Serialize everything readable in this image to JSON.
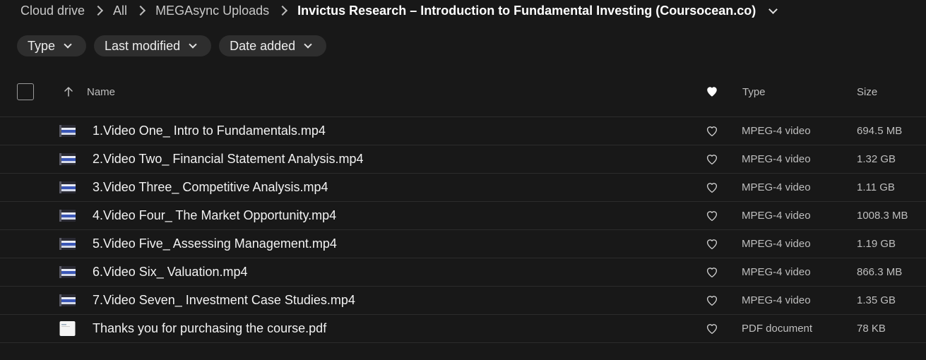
{
  "breadcrumb": {
    "items": [
      "Cloud drive",
      "All",
      "MEGAsync Uploads"
    ],
    "current": "Invictus Research – Introduction to Fundamental Investing (Coursocean.co)"
  },
  "filters": [
    {
      "label": "Type"
    },
    {
      "label": "Last modified"
    },
    {
      "label": "Date added"
    }
  ],
  "table": {
    "columns": {
      "name": "Name",
      "type": "Type",
      "size": "Size"
    },
    "rows": [
      {
        "name": "1.Video One_ Intro to Fundamentals.mp4",
        "type": "MPEG-4 video",
        "size": "694.5 MB",
        "icon": "video-thumbnail-icon"
      },
      {
        "name": "2.Video Two_ Financial Statement Analysis.mp4",
        "type": "MPEG-4 video",
        "size": "1.32 GB",
        "icon": "video-thumbnail-icon"
      },
      {
        "name": "3.Video Three_ Competitive Analysis.mp4",
        "type": "MPEG-4 video",
        "size": "1.11 GB",
        "icon": "video-thumbnail-icon"
      },
      {
        "name": "4.Video Four_ The Market Opportunity.mp4",
        "type": "MPEG-4 video",
        "size": "1008.3 MB",
        "icon": "video-thumbnail-icon"
      },
      {
        "name": "5.Video Five_ Assessing Management.mp4",
        "type": "MPEG-4 video",
        "size": "1.19 GB",
        "icon": "video-thumbnail-icon"
      },
      {
        "name": "6.Video Six_ Valuation.mp4",
        "type": "MPEG-4 video",
        "size": "866.3 MB",
        "icon": "video-thumbnail-icon"
      },
      {
        "name": "7.Video Seven_ Investment Case Studies.mp4",
        "type": "MPEG-4 video",
        "size": "1.35 GB",
        "icon": "video-thumbnail-icon"
      },
      {
        "name": "Thanks you for purchasing the course.pdf",
        "type": "PDF document",
        "size": "78 KB",
        "icon": "pdf-thumbnail-icon"
      }
    ]
  },
  "colors": {
    "background": "#181818",
    "chip": "#2e2e2e",
    "divider": "#2c2c2c"
  }
}
